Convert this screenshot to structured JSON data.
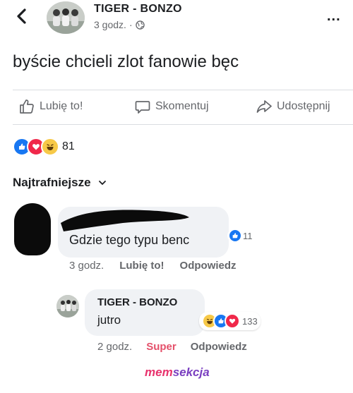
{
  "header": {
    "page_name": "TIGER - BONZO",
    "time": "3 godz.",
    "separator": "·",
    "back_icon": "chevron-left-icon",
    "privacy_icon": "globe-icon",
    "more_icon": "more-dots-icon",
    "more_label": "..."
  },
  "post": {
    "text": "byście chcieli zlot fanowie bęc"
  },
  "actions": {
    "like": "Lubię to!",
    "comment": "Skomentuj",
    "share": "Udostępnij"
  },
  "reactions": {
    "types": [
      "like",
      "love",
      "haha"
    ],
    "count": "81"
  },
  "comments_sort": {
    "label": "Najtrafniejsze"
  },
  "comment": {
    "text": "Gdzie tego typu benc",
    "reaction_count": "11",
    "time": "3 godz.",
    "like": "Lubię to!",
    "reply": "Odpowiedz"
  },
  "reply": {
    "author": "TIGER - BONZO",
    "text": "jutro",
    "reaction_count": "133",
    "time": "2 godz.",
    "reaction_label": "Super",
    "reply": "Odpowiedz"
  },
  "watermark": {
    "part1": "mem",
    "part2": "sekcja"
  },
  "colors": {
    "like_blue": "#1877f2",
    "love_red": "#f0284a",
    "haha_yellow": "#f7c948",
    "super_pink": "#e4506a",
    "secondary_text": "#65676b",
    "bubble_bg": "#f0f2f5"
  }
}
